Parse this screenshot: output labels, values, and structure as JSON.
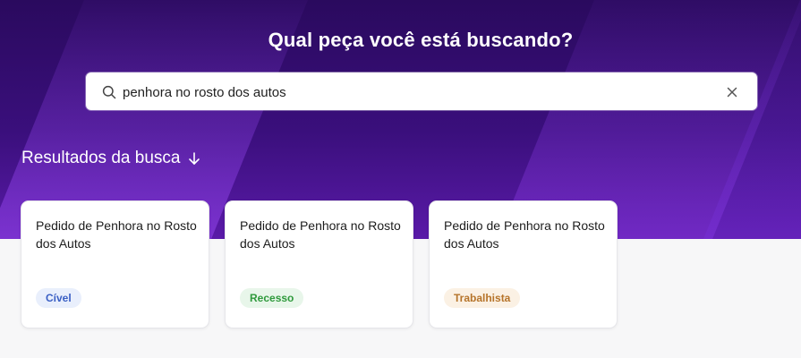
{
  "header": {
    "title": "Qual peça você está buscando?"
  },
  "search": {
    "value": "penhora no rosto dos autos",
    "placeholder": ""
  },
  "results": {
    "heading": "Resultados da busca",
    "cards": [
      {
        "title": "Pedido de Penhora no Rosto dos Autos",
        "tag": "Cível",
        "tag_color": "#3a5fc4",
        "tag_bg": "#e9effc"
      },
      {
        "title": "Pedido de Penhora no Rosto dos Autos",
        "tag": "Recesso",
        "tag_color": "#2f9a3c",
        "tag_bg": "#e8f6ea"
      },
      {
        "title": "Pedido de Penhora no Rosto dos Autos",
        "tag": "Trabalhista",
        "tag_color": "#b6742a",
        "tag_bg": "#fbf1e4"
      }
    ]
  },
  "icons": [
    "search-icon",
    "close-icon",
    "arrow-down-icon"
  ],
  "colors": {
    "hero_dark": "#2a0a5e",
    "hero_accent": "#5a1aa8",
    "page_bg": "#f7f7f8"
  }
}
